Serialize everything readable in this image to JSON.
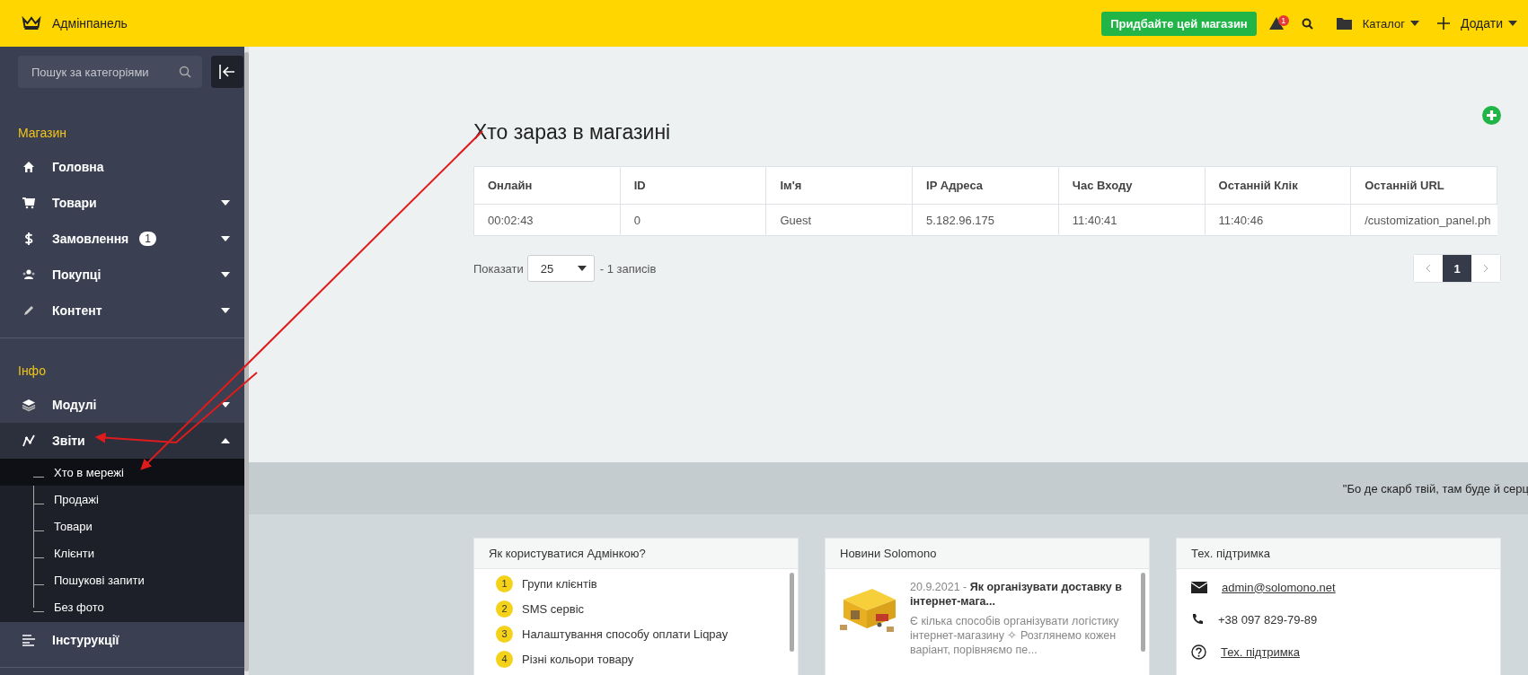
{
  "header": {
    "title": "Адмінпанель",
    "buy_button": "Придбайте цей магазин",
    "alert_count": "1",
    "catalog_menu": "Каталог",
    "add_menu": "Додати"
  },
  "sidebar": {
    "search": {
      "placeholder": "Пошук за категоріями"
    },
    "sections": [
      {
        "title": "Магазин",
        "items": [
          {
            "label": "Головна",
            "kind": "link",
            "selected": false
          },
          {
            "label": "Товари",
            "kind": "group",
            "expanded": false,
            "selected": false
          },
          {
            "label": "Замовлення",
            "kind": "group",
            "expanded": false,
            "selected": false,
            "badge": "1"
          },
          {
            "label": "Покупці",
            "kind": "group",
            "expanded": false,
            "selected": false
          },
          {
            "label": "Контент",
            "kind": "group",
            "expanded": false,
            "selected": false
          }
        ]
      },
      {
        "title": "Інфо",
        "items": [
          {
            "label": "Модулі",
            "kind": "group",
            "expanded": false,
            "selected": false
          },
          {
            "label": "Звіти",
            "kind": "group",
            "expanded": true,
            "selected": true,
            "children": [
              {
                "label": "Хто в мережі",
                "selected": true
              },
              {
                "label": "Продажі",
                "selected": false
              },
              {
                "label": "Товари",
                "selected": false
              },
              {
                "label": "Клієнти",
                "selected": false
              },
              {
                "label": "Пошукові запити",
                "selected": false
              },
              {
                "label": "Без фото",
                "selected": false
              }
            ]
          },
          {
            "label": "Інстурукції",
            "kind": "link",
            "selected": false
          }
        ]
      }
    ]
  },
  "main": {
    "title": "Хто зараз в магазині",
    "table": {
      "columns": [
        "Онлайн",
        "ID",
        "Ім'я",
        "IP Адреса",
        "Час Входу",
        "Останній Клік",
        "Останній URL"
      ],
      "rows": [
        [
          "00:02:43",
          "0",
          "Guest",
          "5.182.96.175",
          "11:40:41",
          "11:40:46",
          "/customization_panel.ph"
        ]
      ]
    },
    "show_label": "Показати",
    "page_size": "25",
    "records_text": "- 1 записів",
    "pages": [
      {
        "label": "1",
        "selected": true
      }
    ]
  },
  "quote": "\"Бо де скарб твій, там буде й серц",
  "cards": {
    "help": {
      "title": "Як користуватися Адмінкою?",
      "items": [
        {
          "number": "1",
          "text": "Групи клієнтів"
        },
        {
          "number": "2",
          "text": "SMS сервіс"
        },
        {
          "number": "3",
          "text": "Налаштування способу оплати Liqpay"
        },
        {
          "number": "4",
          "text": "Різні кольори товару"
        }
      ]
    },
    "news": {
      "title": "Новини Solomono",
      "headline": "20.9.2021 - **Як організувати доставку в інтернет-мага...**",
      "text": "Є кілька способів організувати логістику інтернет-магазину ✧ Розглянемо кожен варіант, порівняємо пе..."
    },
    "support": {
      "title": "Тех. підтримка",
      "email": "admin@solomono.net",
      "phone": "+38 097 829-79-89",
      "link": "Тех. підтримка"
    }
  }
}
